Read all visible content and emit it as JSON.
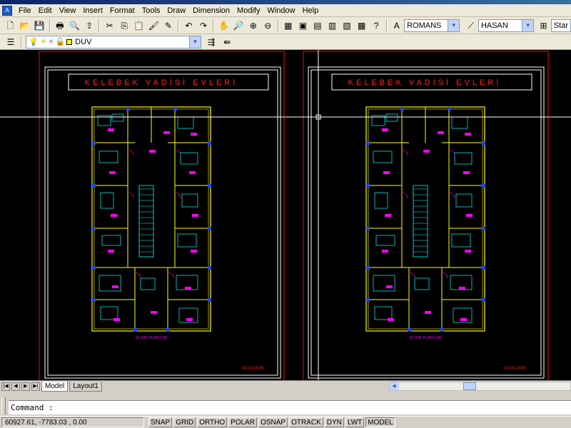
{
  "menu": {
    "items": [
      "File",
      "Edit",
      "View",
      "Insert",
      "Format",
      "Tools",
      "Draw",
      "Dimension",
      "Modify",
      "Window",
      "Help"
    ]
  },
  "toolbar": {
    "text_style_value": "ROMANS",
    "dim_style_value": "HASAN",
    "table_style_partial": "Star"
  },
  "layers": {
    "current_layer": "DUV"
  },
  "drawing": {
    "sheet_title": "KELEBEK VADİSİ EVLERİ",
    "date_left": "03.03.2005",
    "date_right": "03.03.2005",
    "plan_caption_left": "(X) KAT PLANI 1/50",
    "plan_caption_right": "(X) KAT PLANI 1/50"
  },
  "tabs": {
    "model": "Model",
    "layout1": "Layout1"
  },
  "command": {
    "prompt": "Command :"
  },
  "status": {
    "coords": "60927.61, -7783.03 , 0.00",
    "buttons": [
      "SNAP",
      "GRID",
      "ORTHO",
      "POLAR",
      "OSNAP",
      "OTRACK",
      "DYN",
      "LWT",
      "MODEL"
    ]
  },
  "colors": {
    "canvas_bg": "#000000",
    "sheet_border": "#ff0000",
    "plan_walls": "#ffff00",
    "plan_furniture": "#00ffff",
    "plan_text": "#ff00ff",
    "title_text": "#ff0000",
    "frame": "#ffffff"
  }
}
